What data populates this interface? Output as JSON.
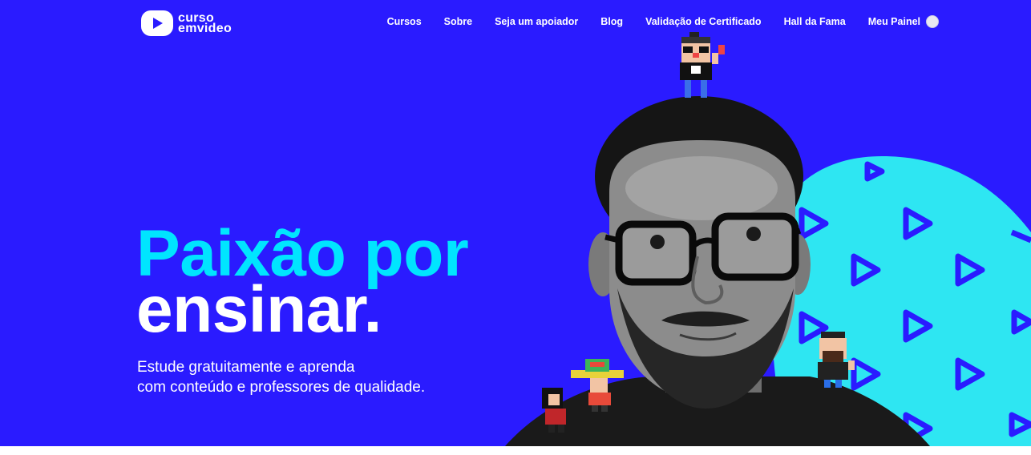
{
  "header": {
    "logo": {
      "line1": "curso",
      "line2": "emvideo"
    },
    "nav": [
      {
        "label": "Cursos"
      },
      {
        "label": "Sobre"
      },
      {
        "label": "Seja um apoiador"
      },
      {
        "label": "Blog"
      },
      {
        "label": "Validação de Certificado"
      },
      {
        "label": "Hall da Fama"
      },
      {
        "label": "Meu Painel"
      }
    ]
  },
  "hero": {
    "headline_line1": "Paixão por",
    "headline_line2": "ensinar.",
    "subtitle_line1": "Estude gratuitamente e aprenda",
    "subtitle_line2": "com conteúdo e professores de qualidade."
  },
  "colors": {
    "background": "#2a1bff",
    "accent_cyan": "#00e5ff",
    "text": "#ffffff"
  }
}
